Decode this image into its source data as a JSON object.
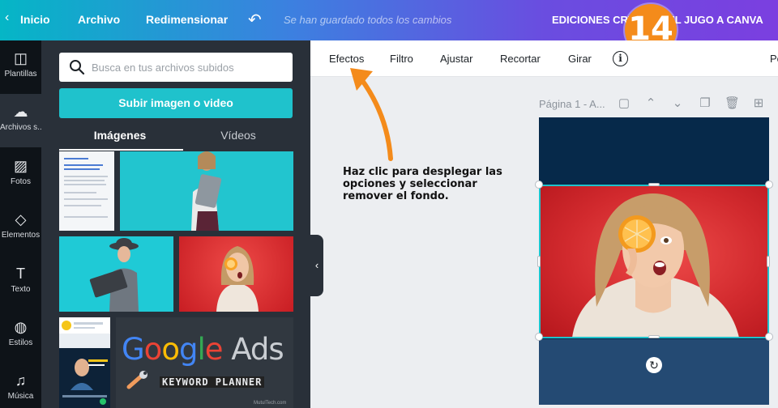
{
  "topbar": {
    "back": "‹",
    "home": "Inicio",
    "file": "Archivo",
    "resize": "Redimensionar",
    "undo": "↶",
    "saved_status": "Se han guardado todos los cambios",
    "document_title": "EDICIONES CRY        E EL JUGO A CANVA",
    "step_badge": "14"
  },
  "rail": {
    "items": [
      {
        "label": "Plantillas",
        "icon": "template-icon",
        "glyph": "◫"
      },
      {
        "label": "Archivos s...",
        "icon": "cloud-upload-icon",
        "glyph": "☁"
      },
      {
        "label": "Fotos",
        "icon": "photo-icon",
        "glyph": "▨"
      },
      {
        "label": "Elementos",
        "icon": "elements-icon",
        "glyph": "◇"
      },
      {
        "label": "Texto",
        "icon": "text-icon",
        "glyph": "T"
      },
      {
        "label": "Estilos",
        "icon": "palette-icon",
        "glyph": "◍"
      },
      {
        "label": "Música",
        "icon": "music-icon",
        "glyph": "♫"
      }
    ]
  },
  "panel": {
    "search_placeholder": "Busca en tus archivos subidos",
    "upload_button": "Subir imagen o video",
    "tabs": [
      "Imágenes",
      "Vídeos"
    ],
    "thumb_text": {
      "google_g": "G",
      "google_o1": "o",
      "google_o2": "o",
      "google_g2": "g",
      "google_l": "l",
      "google_e": "e",
      "ads": " Ads",
      "keyword_planner": "KEYWORD PLANNER",
      "credit": "MutulTech.com"
    },
    "collapse": "‹"
  },
  "toolbar": {
    "effects": "Efectos",
    "filter": "Filtro",
    "adjust": "Ajustar",
    "crop": "Recortar",
    "rotate": "Girar",
    "info": "i",
    "position_partial": "Po"
  },
  "page": {
    "label": "Página 1 - A...",
    "icons": [
      "note-icon",
      "chevron-up-icon",
      "chevron-down-icon",
      "duplicate-icon",
      "trash-icon",
      "add-page-icon"
    ]
  },
  "annotation": {
    "text": "Haz clic para desplegar las opciones y seleccionar remover el fondo."
  },
  "colors": {
    "accent": "#1fc2cc",
    "arrow": "#f48b1b",
    "panel": "#293039",
    "rail": "#0e1318"
  }
}
